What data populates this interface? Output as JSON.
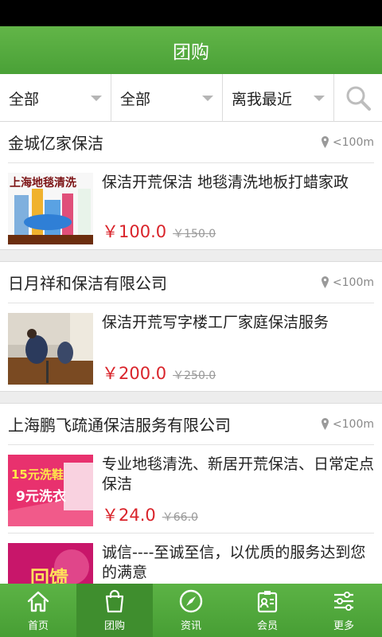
{
  "header": {
    "title": "团购"
  },
  "filters": [
    {
      "label": "全部"
    },
    {
      "label": "全部"
    },
    {
      "label": "离我最近"
    }
  ],
  "shops": [
    {
      "name": "金城亿家保洁",
      "distance": "<100m",
      "deals": [
        {
          "title": "保洁开荒保洁 地毯清洗地板打蜡家政",
          "price": "￥100.0",
          "original_price": "￥150.0",
          "image_text": "上海地毯清洗"
        }
      ]
    },
    {
      "name": "日月祥和保洁有限公司",
      "distance": "<100m",
      "deals": [
        {
          "title": "保洁开荒写字楼工厂家庭保洁服务",
          "price": "￥200.0",
          "original_price": "￥250.0"
        }
      ]
    },
    {
      "name": "上海鹏飞疏通保洁服务有限公司",
      "distance": "<100m",
      "deals": [
        {
          "title": "专业地毯清洗、新居开荒保洁、日常定点保洁",
          "price": "￥24.0",
          "original_price": "￥66.0",
          "image_text_1": "15元洗鞋",
          "image_text_2": "9元洗衣"
        },
        {
          "title": "诚信----至诚至信，以优质的服务达到您的满意",
          "image_text": "回馈"
        }
      ]
    }
  ],
  "tabbar": [
    {
      "label": "首页",
      "icon": "home-icon"
    },
    {
      "label": "团购",
      "icon": "bag-icon"
    },
    {
      "label": "资讯",
      "icon": "compass-icon"
    },
    {
      "label": "会员",
      "icon": "member-card-icon"
    },
    {
      "label": "更多",
      "icon": "sliders-icon"
    }
  ],
  "colors": {
    "brand_green": "#4aa137",
    "price_red": "#d9232a"
  }
}
